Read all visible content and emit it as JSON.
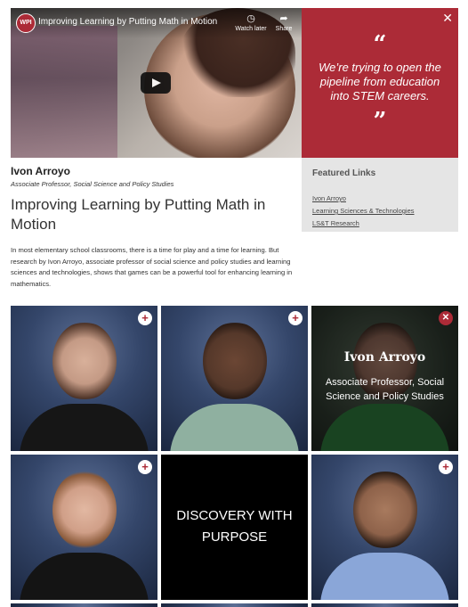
{
  "video": {
    "logo_text": "WPI",
    "title": "Improving Learning by Putting Math in Motion",
    "watch_later": "Watch later",
    "share": "Share"
  },
  "quote": {
    "open_mark": "“",
    "text": "We’re trying to open the pipeline from education into STEM careers.",
    "close_mark": "”",
    "close_label": "✕"
  },
  "person": {
    "name": "Ivon Arroyo",
    "role": "Associate Professor, Social Science and Policy Studies"
  },
  "article": {
    "title": "Improving Learning by Putting Math in Motion",
    "body": "In most elementary school classrooms, there is a time for play and a time for learning. But research by Ivon Arroyo, associate professor of social science and policy studies and learning sciences and technologies, shows that games can be a powerful tool for enhancing learning in mathematics."
  },
  "featured_links": {
    "heading": "Featured Links",
    "items": [
      "Ivon Arroyo",
      "Learning Sciences & Technologies",
      "LS&T Research"
    ]
  },
  "grid": {
    "plus_label": "+",
    "close_label": "✕",
    "active_name": "Ivon Arroyo",
    "active_role": "Associate Professor, Social Science and Policy Studies",
    "tagline": "DISCOVERY WITH PURPOSE"
  },
  "colors": {
    "brand": "#ac2b37",
    "links_bg": "#e5e5e5"
  }
}
